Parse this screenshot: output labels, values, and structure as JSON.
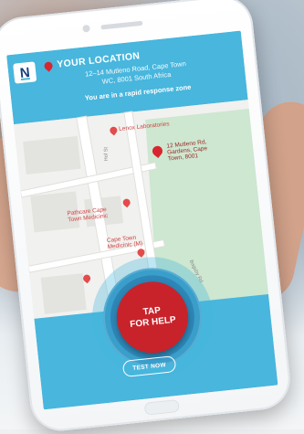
{
  "brand": {
    "logo_letter": "N"
  },
  "header": {
    "title": "YOUR LOCATION",
    "address_line1": "12–14 Mutleno Road, Cape Town",
    "address_line2": "WC, 8001 South Africa",
    "zone_status": "You are in a rapid response zone"
  },
  "map": {
    "places": [
      {
        "label": "Lenox Laboratories"
      },
      {
        "label": "Pathcare Cape Town Medicinic"
      },
      {
        "label": "Cape Town Medicinic (M)"
      }
    ],
    "current_pin_label": "12 Mutleno Rd, Gardens, Cape Town, 8001",
    "streets": [
      "Hof St",
      "Bagsby Rd"
    ]
  },
  "panic": {
    "line1": "TAP",
    "line2": "FOR HELP"
  },
  "test_button": {
    "label": "TEST NOW"
  },
  "colors": {
    "accent": "#48b6dd",
    "alert": "#c8232b",
    "brand_navy": "#173f79",
    "park": "#cde7d0"
  }
}
